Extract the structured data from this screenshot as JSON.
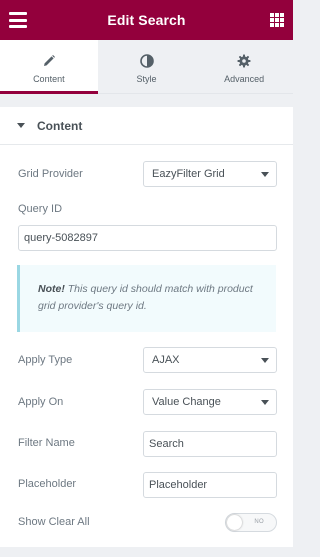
{
  "header": {
    "title": "Edit Search",
    "menu_icon": "hamburger-menu-icon",
    "grid_icon": "apps-grid-icon",
    "bg_color": "#93003c"
  },
  "tabs": [
    {
      "label": "Content",
      "icon": "pencil-icon",
      "active": true
    },
    {
      "label": "Style",
      "icon": "contrast-icon",
      "active": false
    },
    {
      "label": "Advanced",
      "icon": "gear-icon",
      "active": false
    }
  ],
  "section": {
    "title": "Content",
    "expanded": true
  },
  "fields": {
    "grid_provider": {
      "label": "Grid Provider",
      "value": "EazyFilter Grid"
    },
    "query_id": {
      "label": "Query ID",
      "value": "query-5082897"
    },
    "note": {
      "strong": "Note!",
      "text": " This query id should match with product grid provider's query id."
    },
    "apply_type": {
      "label": "Apply Type",
      "value": "AJAX"
    },
    "apply_on": {
      "label": "Apply On",
      "value": "Value Change"
    },
    "filter_name": {
      "label": "Filter Name",
      "value": "Search"
    },
    "placeholder": {
      "label": "Placeholder",
      "value": "Placeholder"
    },
    "show_clear_all": {
      "label": "Show Clear All",
      "toggle_text": "NO",
      "enabled": false
    }
  }
}
